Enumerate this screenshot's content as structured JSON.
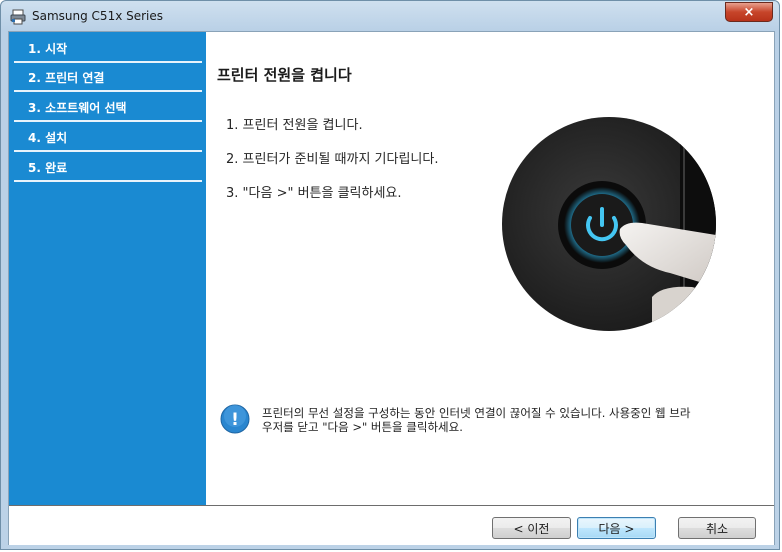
{
  "window": {
    "title": "Samsung C51x Series",
    "close_label": "×"
  },
  "sidebar": {
    "steps": [
      {
        "label": "1. 시작"
      },
      {
        "label": "2. 프린터 연결"
      },
      {
        "label": "3. 소프트웨어 선택"
      },
      {
        "label": "4. 설치"
      },
      {
        "label": "5. 완료"
      }
    ]
  },
  "main": {
    "heading": "프린터 전원을 켭니다",
    "instructions": [
      "1. 프린터 전원을 켭니다.",
      "2. 프린터가 준비될 때까지 기다립니다.",
      "3. \"다음 >\" 버튼을 클릭하세요."
    ],
    "info_line1": "프린터의 무선 설정을 구성하는 동안 인터넷 연결이 끊어질 수 있습니다. 사용중인 웹 브라",
    "info_line2": "우저를 닫고 \"다음 >\" 버튼을 클릭하세요.",
    "info_icon_glyph": "!"
  },
  "footer": {
    "back_label": "< 이전",
    "next_label": "다음 >",
    "cancel_label": "취소"
  },
  "colors": {
    "sidebar_bg": "#1a8ad2",
    "power_glow": "#2fb6ea"
  }
}
